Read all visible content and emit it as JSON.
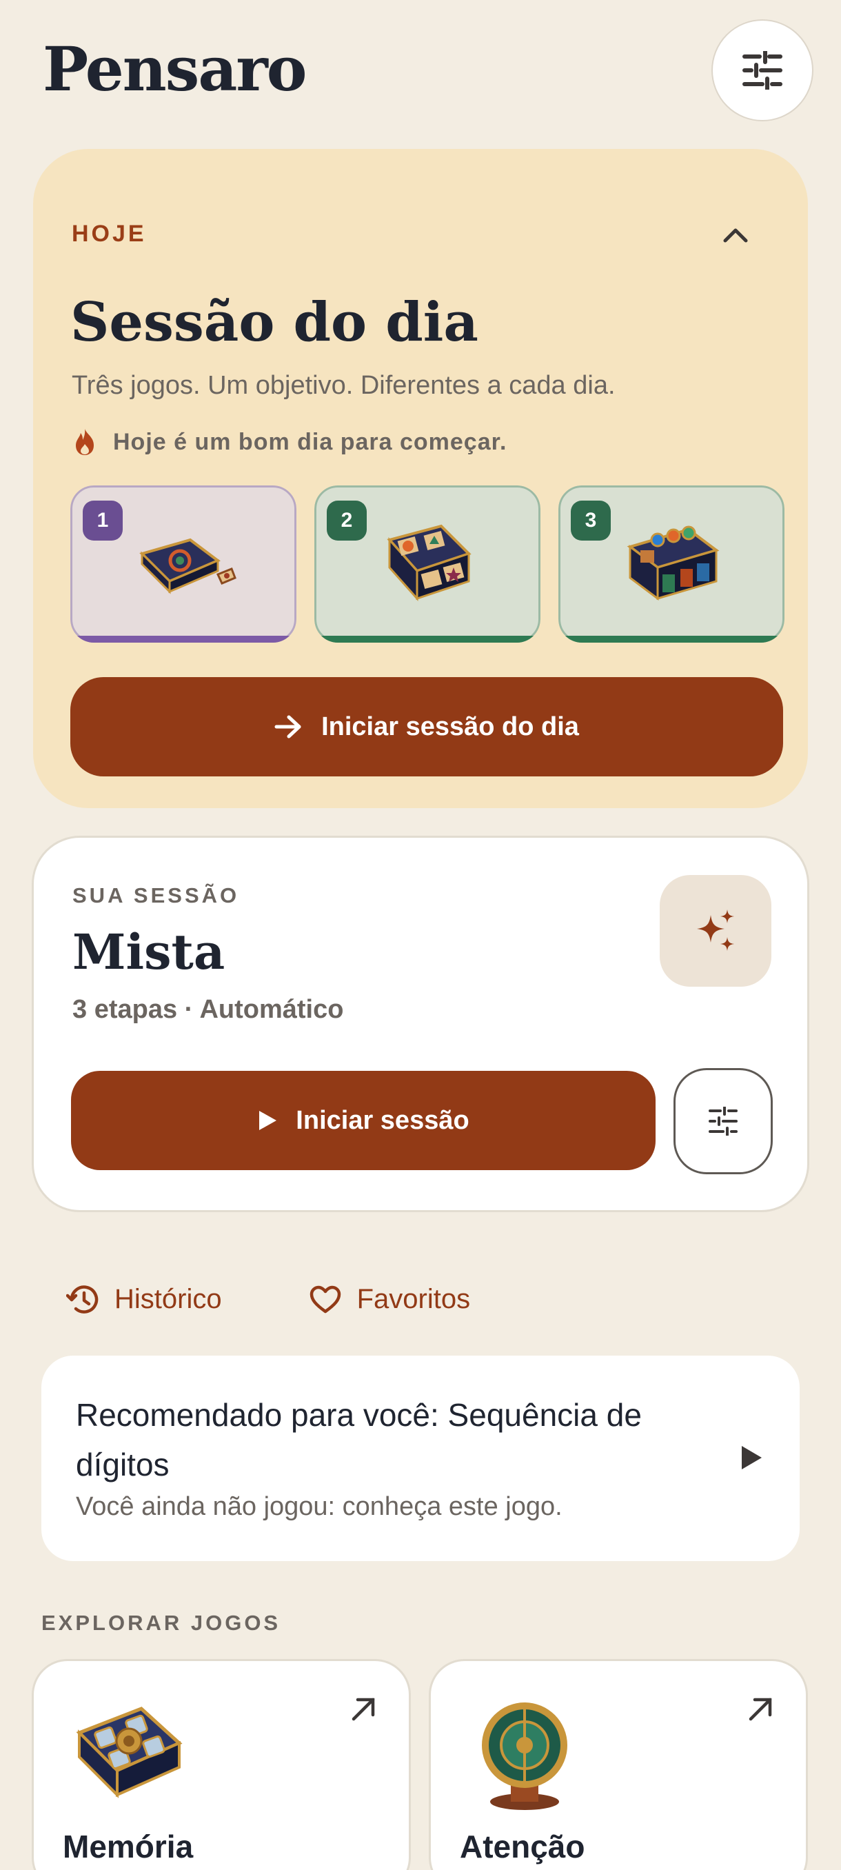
{
  "header": {
    "app_title": "Pensaro"
  },
  "daily": {
    "tag": "HOJE",
    "title": "Sessão do dia",
    "subtitle": "Três jogos. Um objetivo. Diferentes a cada dia.",
    "hint": "Hoje é um bom dia para começar.",
    "tiles": [
      {
        "number": "1",
        "badge_color": "#6a4e92",
        "bg": "#e6dcdc",
        "bar_color": "#7c5aa6",
        "border": "#b8a8c4"
      },
      {
        "number": "2",
        "badge_color": "#2e6a4c",
        "bg": "#d8e0d2",
        "bar_color": "#2e7a52",
        "border": "#9cbaa4"
      },
      {
        "number": "3",
        "badge_color": "#2e6a4c",
        "bg": "#d9e0d2",
        "bar_color": "#2e7a52",
        "border": "#9cbaa4"
      }
    ],
    "start_label": "Iniciar sessão do dia"
  },
  "session": {
    "tag": "SUA SESSÃO",
    "title": "Mista",
    "meta": "3 etapas · Automático",
    "start_label": "Iniciar sessão"
  },
  "links": {
    "history_label": "Histórico",
    "favorites_label": "Favoritos"
  },
  "recommendation": {
    "title": "Recomendado para você: Sequência de dígitos",
    "subtitle": "Você ainda não jogou: conheça este jogo."
  },
  "explore": {
    "tag": "EXPLORAR JOGOS",
    "cards": [
      {
        "name": "Memória"
      },
      {
        "name": "Atenção"
      }
    ]
  },
  "colors": {
    "accent": "#923a16",
    "background": "#f3ede2",
    "daily_card": "#f6e4c0"
  }
}
